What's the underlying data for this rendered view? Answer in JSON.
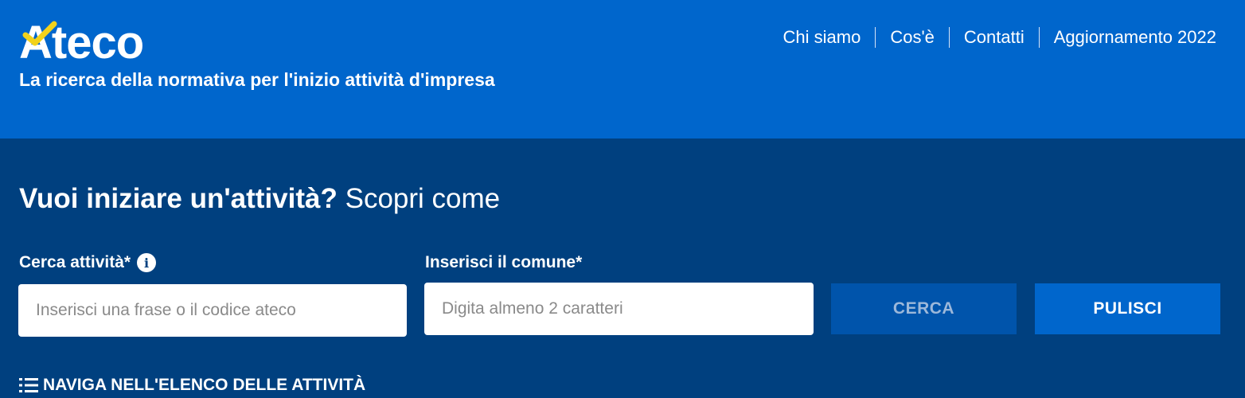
{
  "header": {
    "logo_text": "Ateco",
    "tagline": "La ricerca della normativa per l'inizio attività d'impresa",
    "nav": [
      {
        "label": "Chi siamo"
      },
      {
        "label": "Cos'è"
      },
      {
        "label": "Contatti"
      },
      {
        "label": "Aggiornamento 2022"
      }
    ]
  },
  "search": {
    "headline_strong": "Vuoi iniziare un'attività?",
    "headline_light": "Scopri come",
    "activity_label": "Cerca attività*",
    "activity_placeholder": "Inserisci una frase o il codice ateco",
    "comune_label": "Inserisci il comune*",
    "comune_placeholder": "Digita almeno 2 caratteri",
    "cerca_button": "CERCA",
    "pulisci_button": "PULISCI",
    "browse_link": "NAVIGA NELL'ELENCO DELLE ATTIVITÀ"
  },
  "icons": {
    "logo_check": "check-icon",
    "info": "info-icon",
    "browse": "numbered-list-icon"
  },
  "colors": {
    "header_bg": "#0066cc",
    "main_bg": "#00407f",
    "check": "#f2d21b",
    "cerca_bg": "#0054ab",
    "pulisci_bg": "#0066cc"
  }
}
